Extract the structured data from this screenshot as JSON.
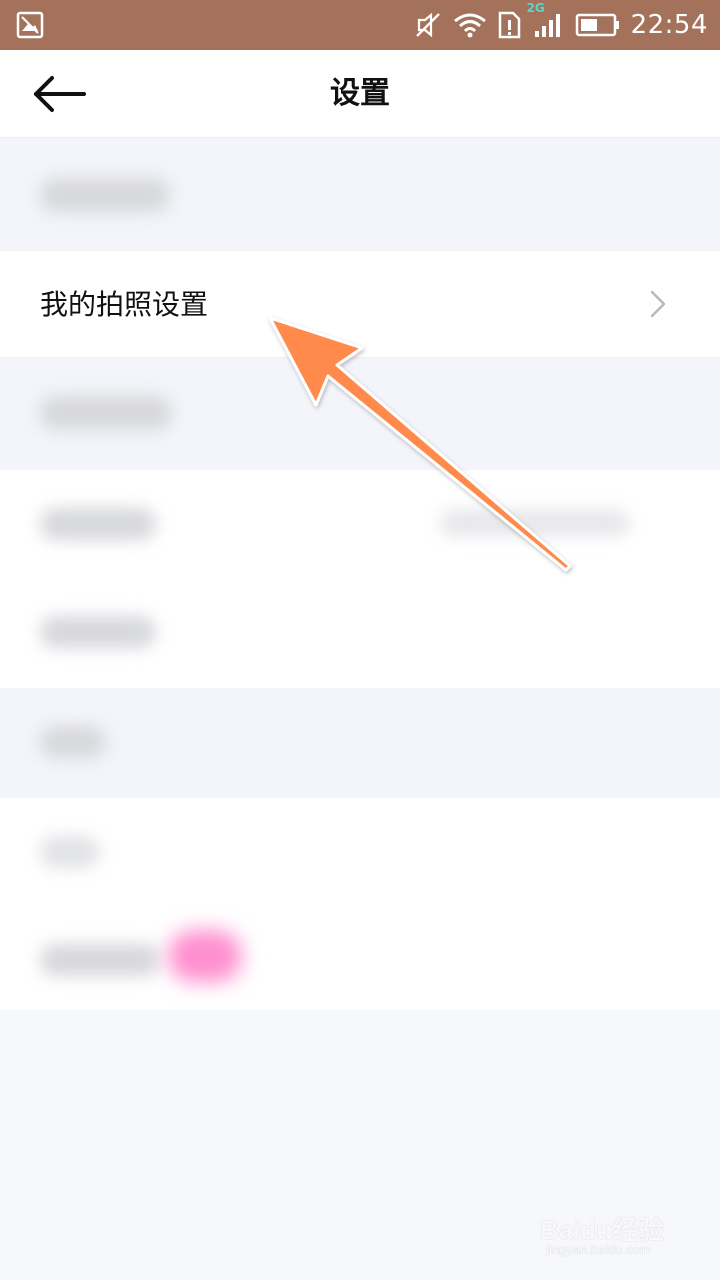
{
  "status_bar": {
    "time": "22:54",
    "network_tag": "2G",
    "icons": [
      "image-icon",
      "mute-icon",
      "wifi-icon",
      "sim-alert-icon",
      "signal-icon",
      "battery-icon"
    ],
    "color": "#a4725b"
  },
  "header": {
    "title": "设置",
    "back_icon": "back-arrow-icon"
  },
  "settings": {
    "photo_settings_label": "我的拍照设置",
    "chevron_icon": "chevron-right-icon"
  },
  "annotation": {
    "color": "#ff8a4c"
  },
  "watermark": {
    "logo": "Baidu经验",
    "sub": "jingyan.baidu.com"
  }
}
